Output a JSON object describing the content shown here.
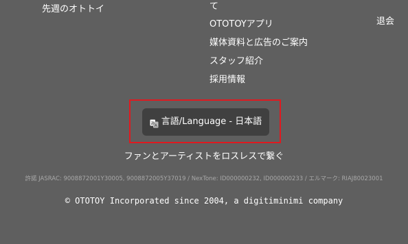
{
  "footer": {
    "left_links": [
      "先週のオトトイ"
    ],
    "center_links": [
      "て",
      "OTOTOYアプリ",
      "媒体資料と広告のご案内",
      "スタッフ紹介",
      "採用情報"
    ],
    "right_links": [
      "退会"
    ]
  },
  "language": {
    "icon": "language-icon",
    "label": "言語/Language - 日本語",
    "highlight_color": "#e0191f"
  },
  "tagline": "ファンとアーティストをロスレスで繋ぐ",
  "rights_notice": "許諾 JASRAC: 9008872001Y30005, 9008872005Y37019 / NexTone: ID000000232, ID000000233 / エルマーク: RIAJ80023001",
  "copyright": "© OTOTOY Incorporated since 2004, a digitiminimi company"
}
